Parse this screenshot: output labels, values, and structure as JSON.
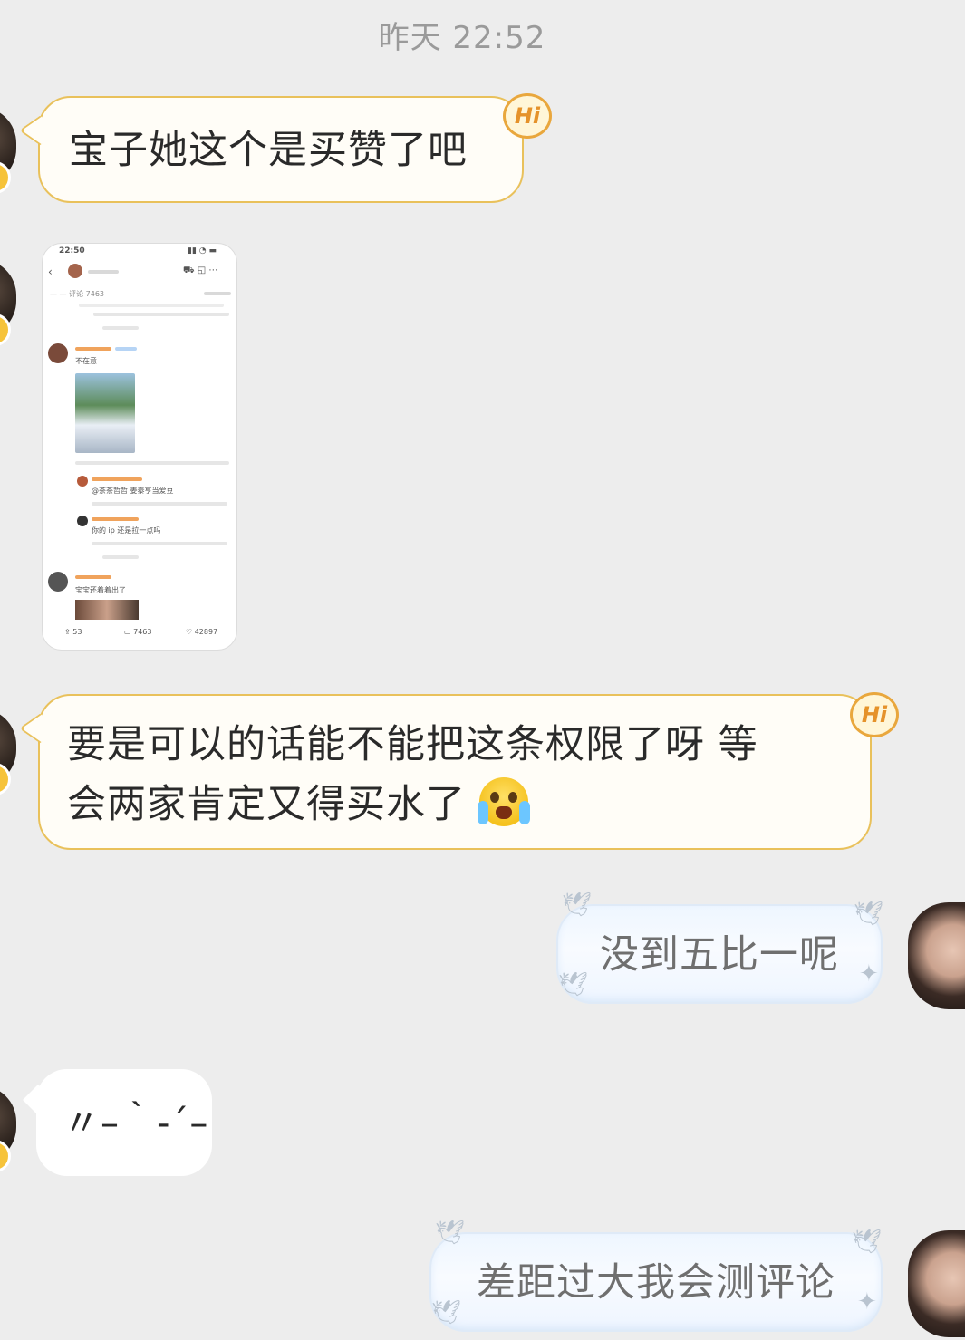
{
  "timestamp": "昨天 22:52",
  "messages": [
    {
      "side": "left",
      "text": "宝子她这个是买赞了吧",
      "badge": "Hi"
    },
    {
      "side": "left",
      "type": "image",
      "screenshot": {
        "status_time": "22:50",
        "tab_label": "评论 7463",
        "comment1_text": "不在意",
        "reply1_text": "@茶茶哲哲 姜泰亨当爱豆",
        "reply2_text": "你的 ip 还是拉一点吗",
        "comment2_text": "宝宝还着着出了",
        "bottom_bar": [
          "53",
          "7463",
          "42897"
        ]
      }
    },
    {
      "side": "left",
      "text_line1": "要是可以的话能不能把这条权限了呀 等",
      "text_line2": "会两家肯定又得买水了",
      "badge": "Hi",
      "emoji": "loudly-crying-face-emoji"
    },
    {
      "side": "right",
      "text": "没到五比一呢"
    },
    {
      "side": "left",
      "text": "〃–｀-´–"
    },
    {
      "side": "right",
      "text": "差距过大我会测评论"
    }
  ]
}
